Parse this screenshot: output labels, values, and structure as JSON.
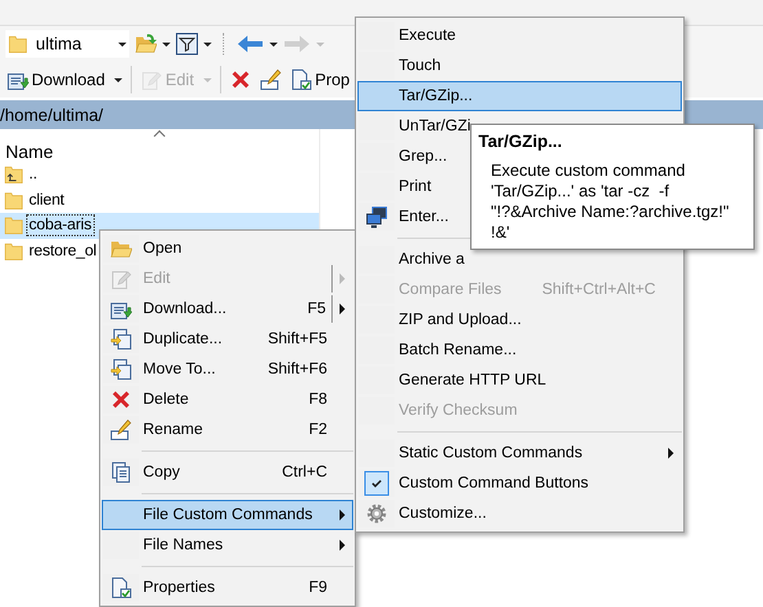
{
  "toolbar": {
    "location": "ultima",
    "buttons": [
      {
        "label": "Download",
        "disabled": false,
        "dropdown": true
      },
      {
        "label": "Edit",
        "disabled": true,
        "dropdown": true
      },
      {
        "disabled": false,
        "dropdown": false
      },
      {
        "disabled": false,
        "dropdown": false
      },
      {
        "label": "Prop",
        "disabled": false,
        "dropdown": false
      }
    ]
  },
  "path": "/home/ultima/",
  "file_list": {
    "columns": [
      "Name"
    ],
    "rows": [
      {
        "name": "..",
        "kind": "parent",
        "selected": false
      },
      {
        "name": "client",
        "kind": "folder",
        "selected": false
      },
      {
        "name": "coba-aris",
        "kind": "folder",
        "selected": true
      },
      {
        "name": "restore_ol",
        "kind": "folder",
        "selected": false
      }
    ]
  },
  "context_menu": [
    {
      "kind": "item",
      "label": "Open",
      "disabled": false,
      "selected": false,
      "submenu": false
    },
    {
      "kind": "split",
      "label": "Edit",
      "disabled": true,
      "selected": false,
      "submenu": true
    },
    {
      "kind": "split",
      "label": "Download...",
      "shortcut": "F5",
      "disabled": false,
      "selected": false,
      "submenu": true
    },
    {
      "kind": "item",
      "label": "Duplicate...",
      "shortcut": "Shift+F5",
      "disabled": false,
      "selected": false,
      "submenu": false
    },
    {
      "kind": "item",
      "label": "Move To...",
      "shortcut": "Shift+F6",
      "disabled": false,
      "selected": false,
      "submenu": false
    },
    {
      "kind": "item",
      "label": "Delete",
      "shortcut": "F8",
      "disabled": false,
      "selected": false,
      "submenu": false
    },
    {
      "kind": "item",
      "label": "Rename",
      "shortcut": "F2",
      "disabled": false,
      "selected": false,
      "submenu": false
    },
    {
      "kind": "separator"
    },
    {
      "kind": "item",
      "label": "Copy",
      "shortcut": "Ctrl+C",
      "disabled": false,
      "selected": false,
      "submenu": false
    },
    {
      "kind": "separator"
    },
    {
      "kind": "item",
      "label": "File Custom Commands",
      "disabled": false,
      "selected": true,
      "submenu": true
    },
    {
      "kind": "item",
      "label": "File Names",
      "disabled": false,
      "selected": false,
      "submenu": true
    },
    {
      "kind": "separator"
    },
    {
      "kind": "item",
      "label": "Properties",
      "shortcut": "F9",
      "disabled": false,
      "selected": false,
      "submenu": false
    }
  ],
  "custom_commands_menu": [
    {
      "kind": "item",
      "label": "Execute",
      "disabled": false,
      "selected": false,
      "checked": false
    },
    {
      "kind": "item",
      "label": "Touch",
      "disabled": false,
      "selected": false,
      "checked": false
    },
    {
      "kind": "item",
      "label": "Tar/GZip...",
      "disabled": false,
      "selected": true,
      "checked": false
    },
    {
      "kind": "item",
      "label": "UnTar/GZi",
      "disabled": false,
      "selected": false,
      "checked": false
    },
    {
      "kind": "item",
      "label": "Grep...",
      "disabled": false,
      "selected": false,
      "checked": false
    },
    {
      "kind": "item",
      "label": "Print",
      "disabled": false,
      "selected": false,
      "checked": false
    },
    {
      "kind": "item",
      "label": "Enter...",
      "disabled": false,
      "selected": false,
      "checked": false
    },
    {
      "kind": "separator"
    },
    {
      "kind": "item",
      "label": "Archive a",
      "disabled": false,
      "selected": false,
      "checked": false
    },
    {
      "kind": "item",
      "label": "Compare Files",
      "shortcut": "Shift+Ctrl+Alt+C",
      "disabled": true,
      "selected": false,
      "checked": false
    },
    {
      "kind": "item",
      "label": "ZIP and Upload...",
      "disabled": false,
      "selected": false,
      "checked": false
    },
    {
      "kind": "item",
      "label": "Batch Rename...",
      "disabled": false,
      "selected": false,
      "checked": false
    },
    {
      "kind": "item",
      "label": "Generate HTTP URL",
      "disabled": false,
      "selected": false,
      "checked": false
    },
    {
      "kind": "item",
      "label": "Verify Checksum",
      "disabled": true,
      "selected": false,
      "checked": false
    },
    {
      "kind": "separator"
    },
    {
      "kind": "submenu",
      "label": "Static Custom Commands",
      "disabled": false,
      "selected": false,
      "checked": false
    },
    {
      "kind": "item",
      "label": "Custom Command Buttons",
      "disabled": false,
      "selected": false,
      "checked": true
    },
    {
      "kind": "item",
      "label": "Customize...",
      "disabled": false,
      "selected": false,
      "checked": false
    }
  ],
  "tooltip": {
    "title": "Tar/GZip...",
    "text": "Execute custom command 'Tar/GZip...' as 'tar -cz  -f \"!?&Archive Name:?archive.tgz!\" !&'"
  }
}
